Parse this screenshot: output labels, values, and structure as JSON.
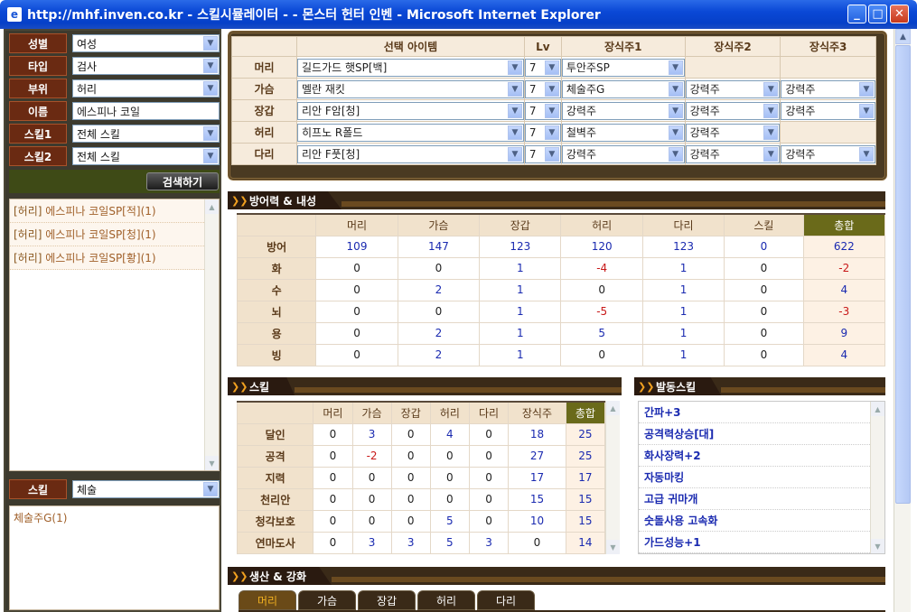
{
  "window": {
    "title": "http://mhf.inven.co.kr - 스킬시뮬레이터 - - 몬스터 헌터 인벤 - Microsoft Internet Explorer",
    "minimize": "_",
    "maximize": "□",
    "close": "✕"
  },
  "filters": {
    "gender": {
      "label": "성별",
      "value": "여성"
    },
    "type": {
      "label": "타입",
      "value": "검사"
    },
    "part": {
      "label": "부위",
      "value": "허리"
    },
    "name": {
      "label": "이름",
      "value": "에스피나 코일"
    },
    "skill1": {
      "label": "스킬1",
      "value": "전체 스킬"
    },
    "skill2": {
      "label": "스킬2",
      "value": "전체 스킬"
    },
    "search_button": "검색하기"
  },
  "search_results": [
    {
      "tag": "[허리]",
      "text": " 에스피나 코일SP[적](1)"
    },
    {
      "tag": "[허리]",
      "text": " 에스피나 코일SP[청](1)"
    },
    {
      "tag": "[허리]",
      "text": " 에스피나 코일SP[황](1)"
    }
  ],
  "skill_filter": {
    "label": "스킬",
    "value": "체술"
  },
  "jewel_results": [
    "체술주G(1)"
  ],
  "equipment": {
    "headers": [
      "",
      "선택 아이템",
      "Lv",
      "장식주1",
      "장식주2",
      "장식주3"
    ],
    "rows": [
      {
        "slot": "머리",
        "item": "길드가드 햇SP[백]",
        "lv": "7",
        "j1": "투안주SP",
        "j2": "",
        "j3": ""
      },
      {
        "slot": "가슴",
        "item": "멜란 재킷",
        "lv": "7",
        "j1": "체술주G",
        "j2": "강력주",
        "j3": "강력주"
      },
      {
        "slot": "장갑",
        "item": "리안 F암[청]",
        "lv": "7",
        "j1": "강력주",
        "j2": "강력주",
        "j3": "강력주"
      },
      {
        "slot": "허리",
        "item": "히프노 R폴드",
        "lv": "7",
        "j1": "철벽주",
        "j2": "강력주",
        "j3": ""
      },
      {
        "slot": "다리",
        "item": "리안 F풋[청]",
        "lv": "7",
        "j1": "강력주",
        "j2": "강력주",
        "j3": "강력주"
      }
    ]
  },
  "defense": {
    "title": "방어력 & 내성",
    "headers": [
      "",
      "머리",
      "가슴",
      "장갑",
      "허리",
      "다리",
      "스킬",
      "총합"
    ],
    "rows": [
      {
        "label": "방어",
        "values": [
          109,
          147,
          123,
          120,
          123,
          0,
          622
        ]
      },
      {
        "label": "화",
        "values": [
          0,
          0,
          1,
          -4,
          1,
          0,
          -2
        ]
      },
      {
        "label": "수",
        "values": [
          0,
          2,
          1,
          0,
          1,
          0,
          4
        ]
      },
      {
        "label": "뇌",
        "values": [
          0,
          0,
          1,
          -5,
          1,
          0,
          -3
        ]
      },
      {
        "label": "용",
        "values": [
          0,
          2,
          1,
          5,
          1,
          0,
          9
        ]
      },
      {
        "label": "빙",
        "values": [
          0,
          2,
          1,
          0,
          1,
          0,
          4
        ]
      }
    ]
  },
  "skills": {
    "title": "스킬",
    "headers": [
      "",
      "머리",
      "가슴",
      "장갑",
      "허리",
      "다리",
      "장식주",
      "총합"
    ],
    "rows": [
      {
        "label": "달인",
        "values": [
          0,
          3,
          0,
          4,
          0,
          18,
          25
        ]
      },
      {
        "label": "공격",
        "values": [
          0,
          -2,
          0,
          0,
          0,
          27,
          25
        ]
      },
      {
        "label": "지력",
        "values": [
          0,
          0,
          0,
          0,
          0,
          17,
          17
        ]
      },
      {
        "label": "천리안",
        "values": [
          0,
          0,
          0,
          0,
          0,
          15,
          15
        ]
      },
      {
        "label": "청각보호",
        "values": [
          0,
          0,
          0,
          5,
          0,
          10,
          15
        ]
      },
      {
        "label": "연마도사",
        "values": [
          0,
          3,
          3,
          5,
          3,
          0,
          14
        ]
      }
    ]
  },
  "active_skills": {
    "title": "발동스킬",
    "items": [
      "간파+3",
      "공격력상승[대]",
      "화사장력+2",
      "자동마킹",
      "고급 귀마개",
      "숫돌사용 고속화",
      "가드성능+1"
    ]
  },
  "production": {
    "title": "생산 & 강화",
    "tabs": [
      "머리",
      "가슴",
      "장갑",
      "허리",
      "다리"
    ]
  },
  "colors": {
    "negative": "#c81818",
    "positive": "#1a2ab0",
    "total_header": "#6a6a1a"
  }
}
